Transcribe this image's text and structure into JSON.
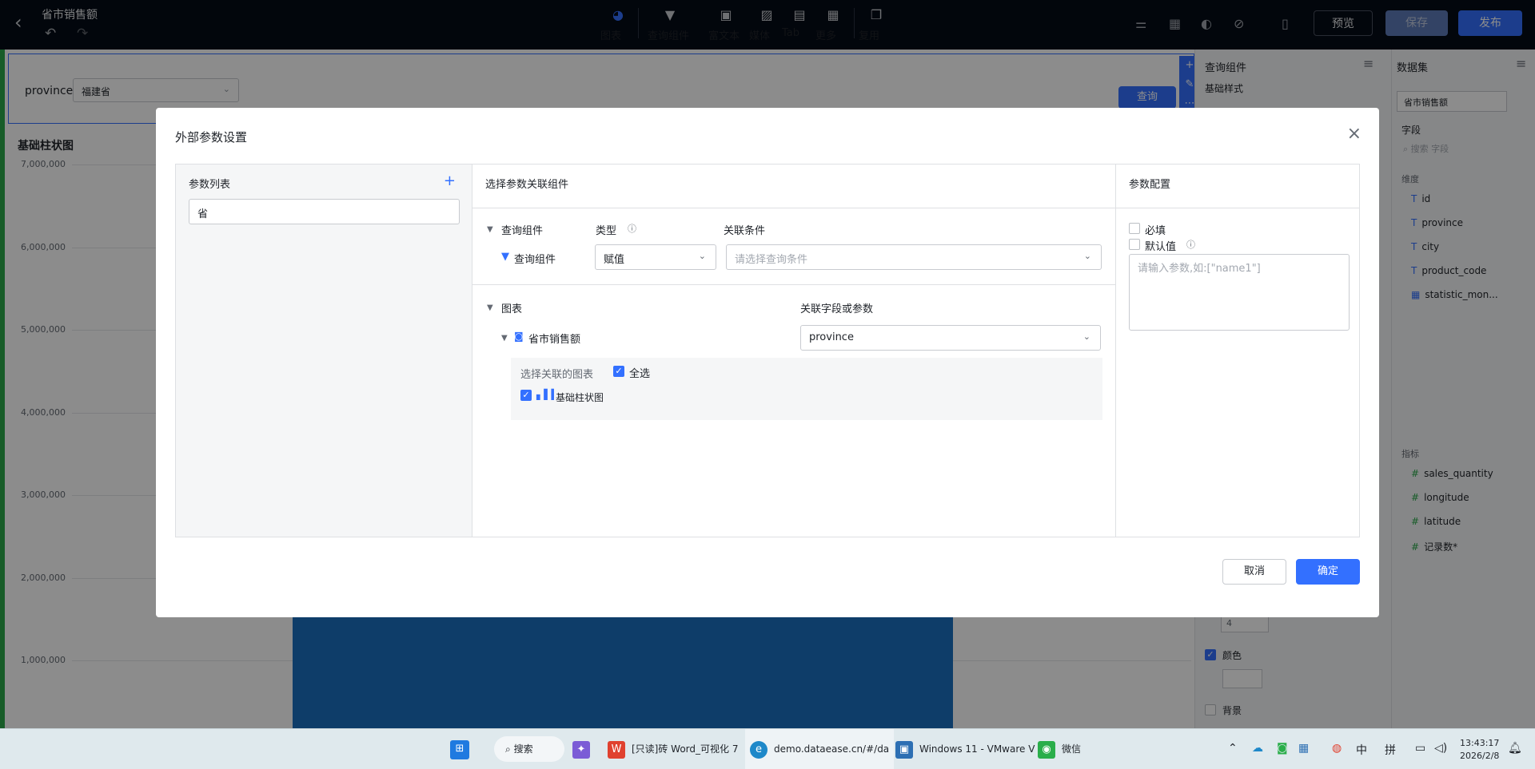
{
  "topbar": {
    "title": "省市销售额",
    "tools": [
      {
        "icon": "pie-chart-icon",
        "label": "图表"
      },
      {
        "icon": "filter-icon",
        "label": "查询组件"
      },
      {
        "icon": "text-icon",
        "label": "富文本"
      },
      {
        "icon": "image-icon",
        "label": "媒体"
      },
      {
        "icon": "tab-icon",
        "label": "Tab"
      },
      {
        "icon": "grid-icon",
        "label": "更多"
      },
      {
        "icon": "copy-icon",
        "label": "复用"
      }
    ],
    "preview_label": "预览",
    "save_label": "保存",
    "publish_label": "发布"
  },
  "canvas": {
    "param_label": "province",
    "param_value": "福建省",
    "query_button": "查询",
    "chart_title": "基础柱状图",
    "y_ticks": [
      "7,000,000",
      "6,000,000",
      "5,000,000",
      "4,000,000",
      "3,000,000",
      "2,000,000",
      "1,000,000"
    ]
  },
  "chart_data": {
    "type": "bar",
    "title": "基础柱状图",
    "y_ticks": [
      1000000,
      2000000,
      3000000,
      4000000,
      5000000,
      6000000,
      7000000
    ],
    "ylim": [
      0,
      7000000
    ],
    "values": [
      6000000
    ]
  },
  "right_panel": {
    "title": "查询组件",
    "section": "基础样式",
    "stepper_value": "4",
    "color_label": "颜色",
    "background_label": "背景"
  },
  "dataset_panel": {
    "title": "数据集",
    "dataset": "省市销售额",
    "fields_label": "字段",
    "search_placeholder": "搜索 字段",
    "dimension_label": "维度",
    "dimensions": [
      "id",
      "province",
      "city",
      "product_code",
      "statistic_mon..."
    ],
    "metric_label": "指标",
    "metrics": [
      "sales_quantity",
      "longitude",
      "latitude",
      "记录数*"
    ]
  },
  "dialog": {
    "title": "外部参数设置",
    "param_list_label": "参数列表",
    "param_name": "省",
    "assoc_header": "选择参数关联组件",
    "query_group": "查询组件",
    "type_label": "类型",
    "condition_label": "关联条件",
    "query_item": "查询组件",
    "type_value": "赋值",
    "condition_placeholder": "请选择查询条件",
    "chart_group": "图表",
    "field_label": "关联字段或参数",
    "chart_item": "省市销售额",
    "field_value": "province",
    "select_chart_label": "选择关联的图表",
    "select_all": "全选",
    "chart_option": "基础柱状图",
    "config_header": "参数配置",
    "required_label": "必填",
    "default_label": "默认值",
    "default_placeholder": "请输入参数,如:[\"name1\"]",
    "cancel": "取消",
    "confirm": "确定"
  },
  "taskbar": {
    "search": "搜索",
    "apps": [
      "[只读]砖 Word_可视化 7",
      "demo.dataease.cn/#/da",
      "Windows 11 - VMware V",
      "微信"
    ],
    "ime1": "中",
    "ime2": "拼",
    "time": "13:43:17",
    "date": "2026/2/8"
  }
}
